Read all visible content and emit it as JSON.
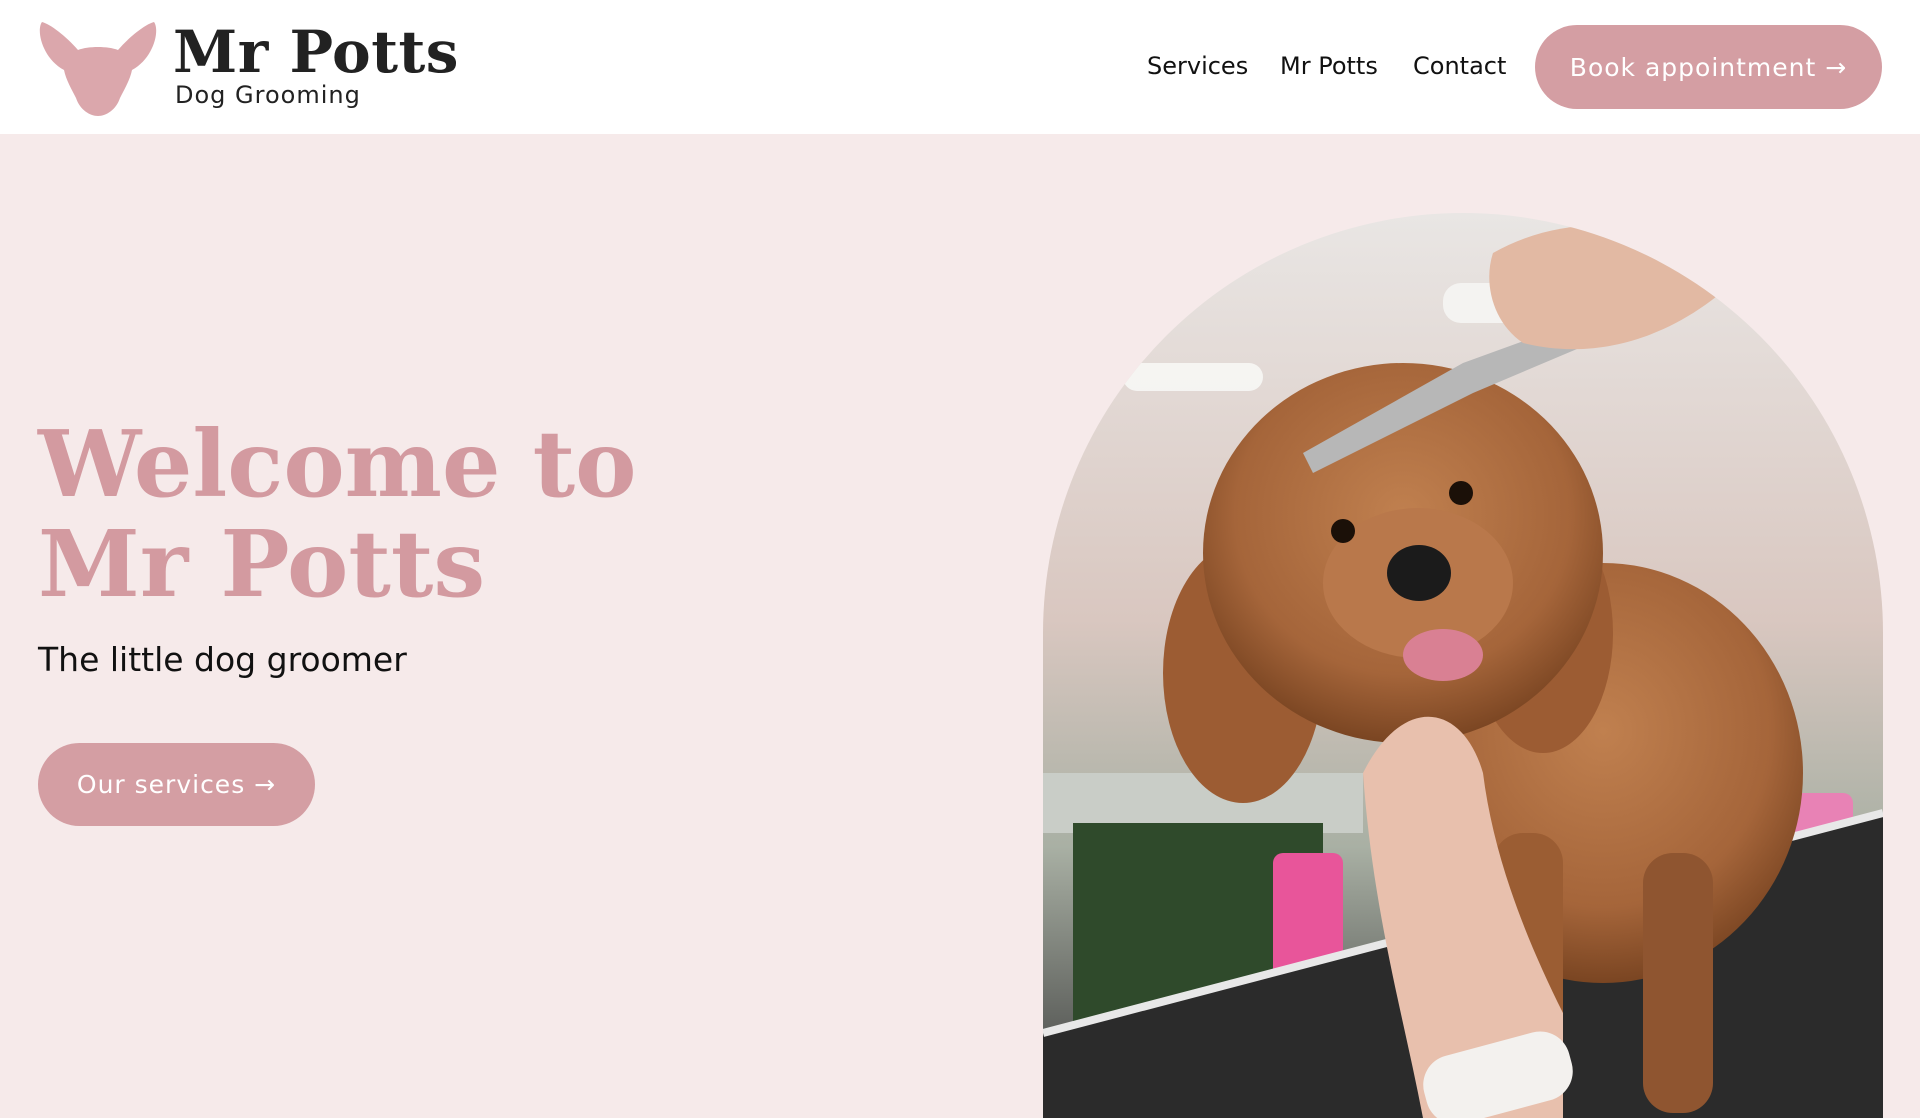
{
  "header": {
    "brand": {
      "name": "Mr Potts",
      "tagline": "Dog Grooming",
      "logo_icon": "dog-head-icon"
    },
    "nav": [
      {
        "label": "Services"
      },
      {
        "label": "Mr Potts"
      },
      {
        "label": "Contact"
      }
    ],
    "cta_label": "Book appointment →"
  },
  "hero": {
    "title": "Welcome to Mr Potts",
    "subtitle": "The little dog groomer",
    "cta_label": "Our services →",
    "image_icon": "groomed-dog-photo"
  },
  "colors": {
    "accent": "#d49ea3",
    "title_pink": "#d39aa0",
    "background": "#f6eaea",
    "header_bg": "#ffffff"
  }
}
